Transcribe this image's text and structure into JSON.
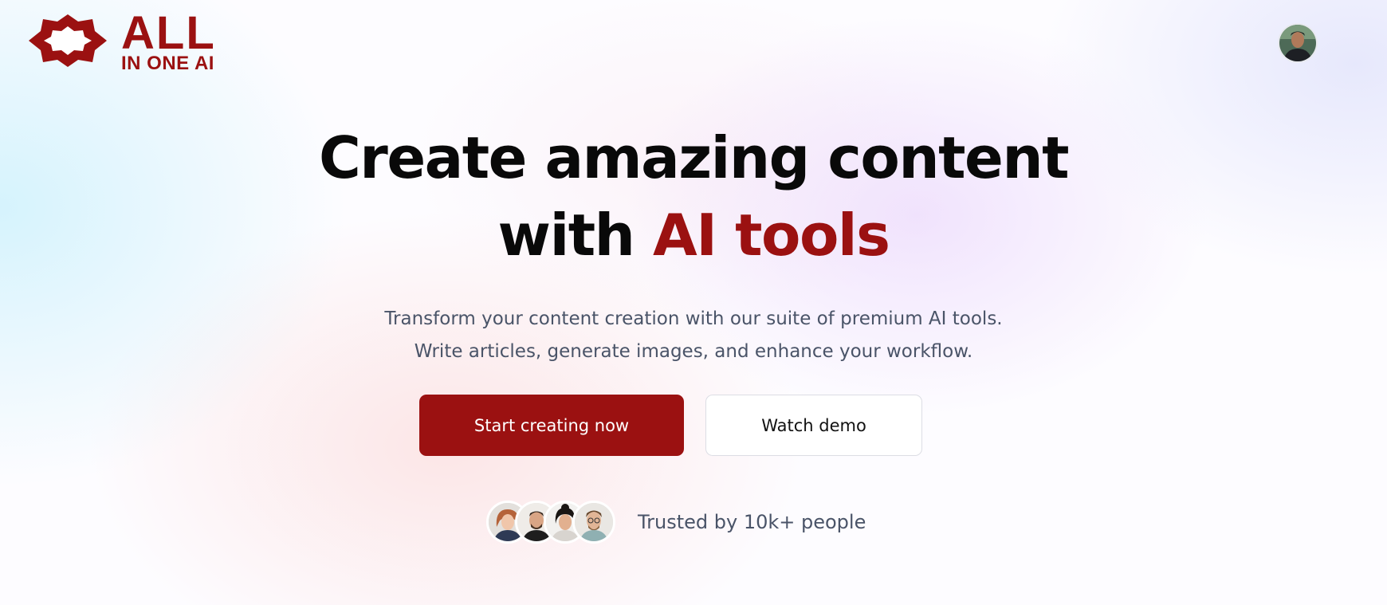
{
  "brand": {
    "logo_line1": "ALL",
    "logo_line2": "IN ONE AI",
    "logo_icon": "star-octagon-icon",
    "color": "#9b1111"
  },
  "header": {
    "avatar": "user-avatar"
  },
  "hero": {
    "title_line1": "Create amazing content",
    "title_line2_prefix": "with ",
    "title_line2_accent": "AI tools",
    "subtitle_line1": "Transform your content creation with our suite of premium AI tools.",
    "subtitle_line2": "Write articles, generate images, and enhance your workflow."
  },
  "actions": {
    "primary_label": "Start creating now",
    "secondary_label": "Watch demo"
  },
  "social_proof": {
    "text": "Trusted by 10k+ people",
    "avatars": [
      "avatar-1",
      "avatar-2",
      "avatar-3",
      "avatar-4"
    ]
  },
  "colors": {
    "accent": "#9b1111",
    "text_dark": "#090909",
    "text_muted": "#4a5468"
  }
}
